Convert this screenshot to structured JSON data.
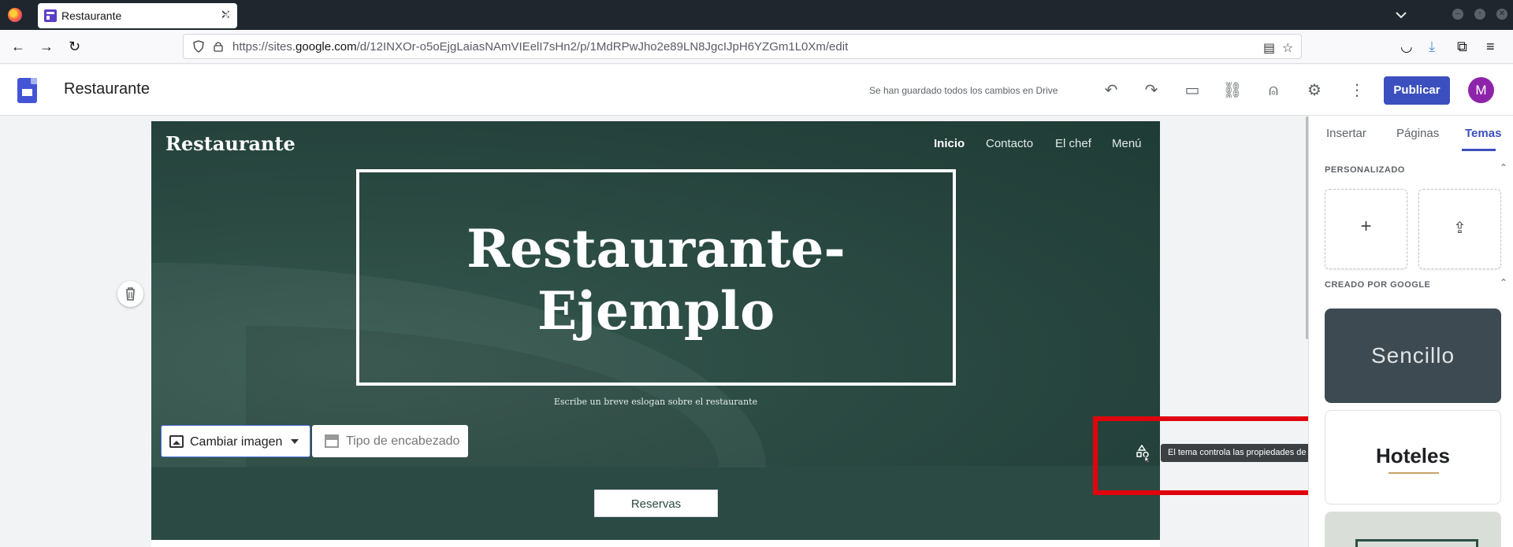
{
  "browser": {
    "tab_title": "Restaurante",
    "url_prefix": "https://sites.",
    "url_host": "google.com",
    "url_path": "/d/12INXOr-o5oEjgLaiasNAmVIEelI7sHn2/p/1MdRPwJho2e89LN8JgcIJpH6YZGm1L0Xm/edit"
  },
  "app": {
    "title": "Restaurante",
    "save_status": "Se han guardado todos los cambios en Drive",
    "publish_label": "Publicar",
    "avatar_initial": "M"
  },
  "site": {
    "name": "Restaurante",
    "nav": [
      "Inicio",
      "Contacto",
      "El chef",
      "Menú"
    ],
    "hero_title_line1": "Restaurante-",
    "hero_title_line2": "Ejemplo",
    "slogan": "Escribe un breve eslogan sobre el restaurante",
    "change_image_label": "Cambiar imagen",
    "header_type_label": "Tipo de encabezado",
    "reservas_label": "Reservas",
    "tooltip": "El tema controla las propiedades de la imagen de fondo"
  },
  "panel": {
    "tabs": [
      "Insertar",
      "Páginas",
      "Temas"
    ],
    "active_tab": "Temas",
    "section_custom": "PERSONALIZADO",
    "section_google": "CREADO POR GOOGLE",
    "themes": [
      "Sencillo",
      "Hoteles"
    ]
  },
  "colors": {
    "accent": "#3c4fbe",
    "hero_bg": "#2b4a44",
    "highlight": "#e0050d"
  }
}
